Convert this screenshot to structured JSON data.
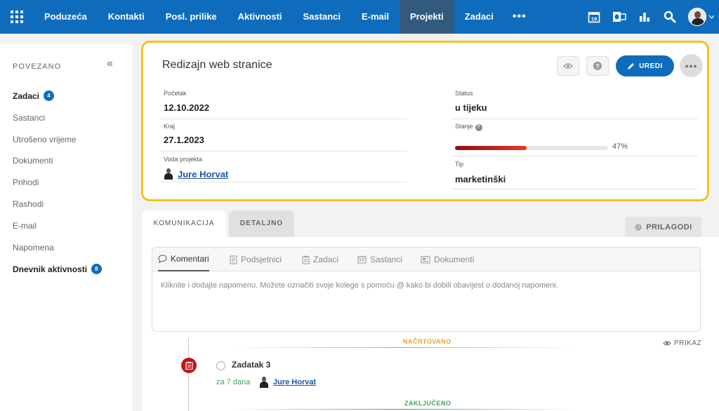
{
  "nav": {
    "items": [
      {
        "label": "Poduzeća",
        "active": false
      },
      {
        "label": "Kontakti",
        "active": false
      },
      {
        "label": "Posl. prilike",
        "active": false
      },
      {
        "label": "Aktivnosti",
        "active": false
      },
      {
        "label": "Sastanci",
        "active": false
      },
      {
        "label": "E-mail",
        "active": false
      },
      {
        "label": "Projekti",
        "active": true
      },
      {
        "label": "Zadaci",
        "active": false
      }
    ],
    "more": "•••",
    "calendar_day": "19"
  },
  "sidebar": {
    "heading": "POVEZANO",
    "items": [
      {
        "label": "Zadaci",
        "badge": "4",
        "bold": true
      },
      {
        "label": "Sastanci",
        "badge": "",
        "bold": false
      },
      {
        "label": "Utrošeno vrijeme",
        "badge": "",
        "bold": false
      },
      {
        "label": "Dokumenti",
        "badge": "",
        "bold": false
      },
      {
        "label": "Prihodi",
        "badge": "",
        "bold": false
      },
      {
        "label": "Rashodi",
        "badge": "",
        "bold": false
      },
      {
        "label": "E-mail",
        "badge": "",
        "bold": false
      },
      {
        "label": "Napomena",
        "badge": "",
        "bold": false
      },
      {
        "label": "Dnevnik aktivnosti",
        "badge": "8",
        "bold": true
      }
    ]
  },
  "project": {
    "title": "Redizajn web stranice",
    "edit_label": "UREDI",
    "start_label": "Početak",
    "start_value": "12.10.2022",
    "end_label": "Kraj",
    "end_value": "27.1.2023",
    "lead_label": "Voda projekta",
    "lead_value": "Jure Horvat",
    "status_label": "Status",
    "status_value": "u tijeku",
    "state_label": "Stanje",
    "progress": 47,
    "progress_text": "47%",
    "type_label": "Tip",
    "type_value": "marketinški"
  },
  "tabs": {
    "items": [
      "KOMUNIKACIJA",
      "DETALJNO"
    ],
    "customize_label": "PRILAGODI"
  },
  "comments": {
    "sub_tabs": [
      "Komentari",
      "Podsjetnici",
      "Zadaci",
      "Sastanci",
      "Dokumenti"
    ],
    "placeholder": "Kliknite i dodajte napomenu. Možete označiti svoje kolege s pomoću @ kako bi dobili obavijest o dodanoj napomeni."
  },
  "timeline": {
    "planned_label": "NAČRTOVANO",
    "show_label": "PRIKAZ",
    "task_name": "Zadatak 3",
    "task_due": "za 7 dana",
    "task_person": "Jure Horvat",
    "done_label": "ZAKLJUČENO",
    "colors": {
      "planned": "#e8a21c",
      "done": "#3aa35b",
      "task": "#c0161b"
    }
  }
}
